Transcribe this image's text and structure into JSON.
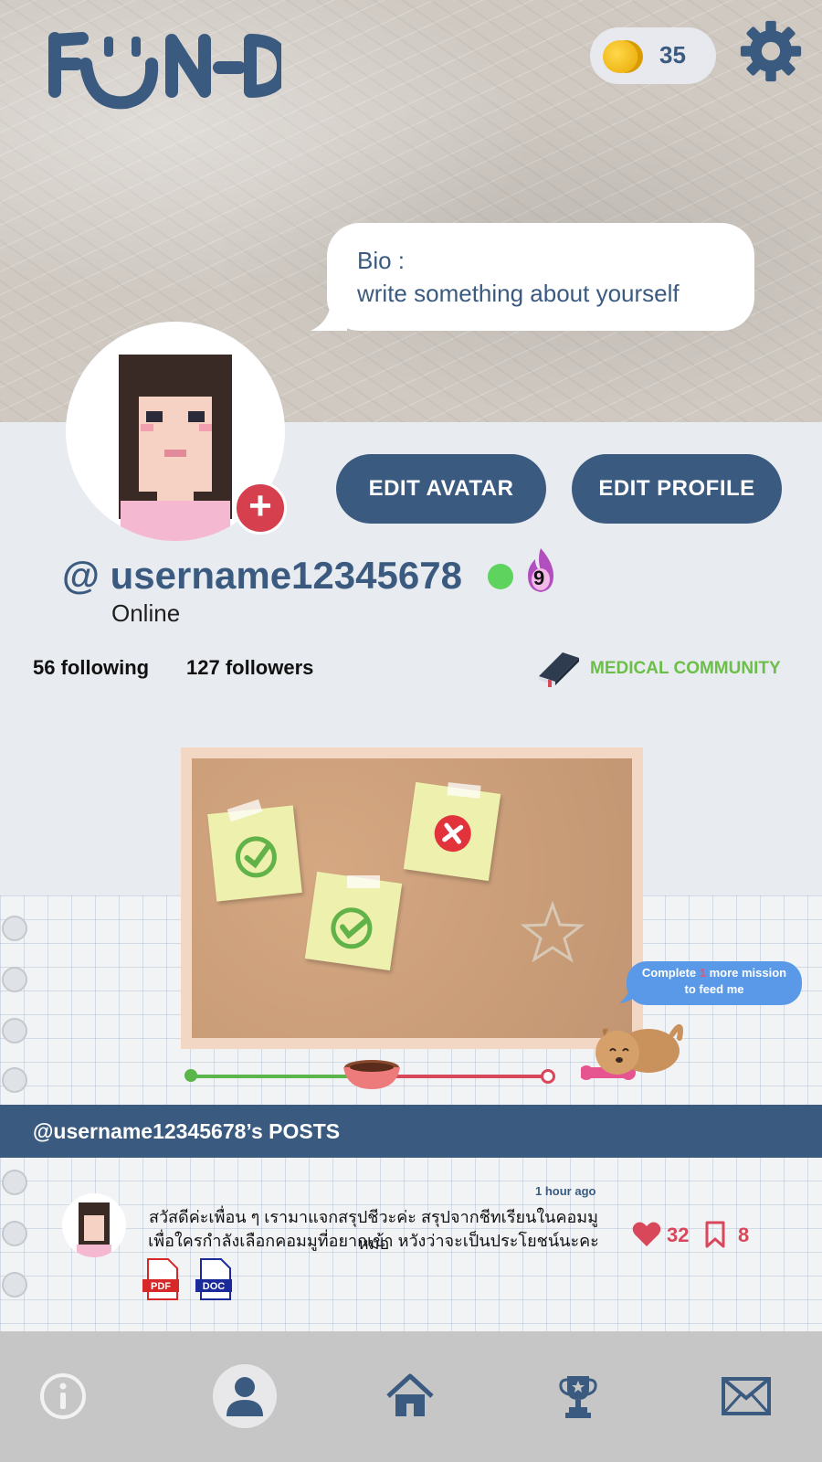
{
  "header": {
    "logo": "F-N-D",
    "coins": "35"
  },
  "bio": {
    "label": "Bio :",
    "text": "write something about yourself"
  },
  "buttons": {
    "edit_avatar": "EDIT AVATAR",
    "edit_profile": "EDIT PROFILE"
  },
  "profile": {
    "username": "@ username12345678",
    "status": "Online",
    "streak": "9",
    "following": "56 following",
    "followers": "127 followers",
    "community": "MEDICAL COMMUNITY"
  },
  "mission": {
    "bubble_prefix": "Complete",
    "bubble_count": "1",
    "bubble_suffix": "more mission",
    "bubble_line2": "to feed me",
    "progress": 0.5
  },
  "posts": {
    "title": "@username12345678’s POSTS",
    "items": [
      {
        "time": "1 hour ago",
        "line1": "สวัสดีค่ะเพื่อน ๆ เรามาแจกสรุปชีวะค่ะ สรุปจากชีทเรียนในคอมมูหมอ",
        "line2": "เพื่อใครกำลังเลือกคอมมูที่อยากเข้า หวังว่าจะเป็นประโยชน์นะคะ",
        "attachments": [
          "PDF",
          "DOC"
        ],
        "likes": "32",
        "saves": "8"
      }
    ]
  },
  "nav": {
    "items": [
      "info-icon",
      "profile-icon",
      "home-icon",
      "trophy-icon",
      "mail-icon"
    ],
    "active": "profile-icon"
  },
  "colors": {
    "primary": "#3a5a80",
    "accent_red": "#d8475a",
    "community_green": "#6bbf48",
    "online": "#5ed35e"
  }
}
